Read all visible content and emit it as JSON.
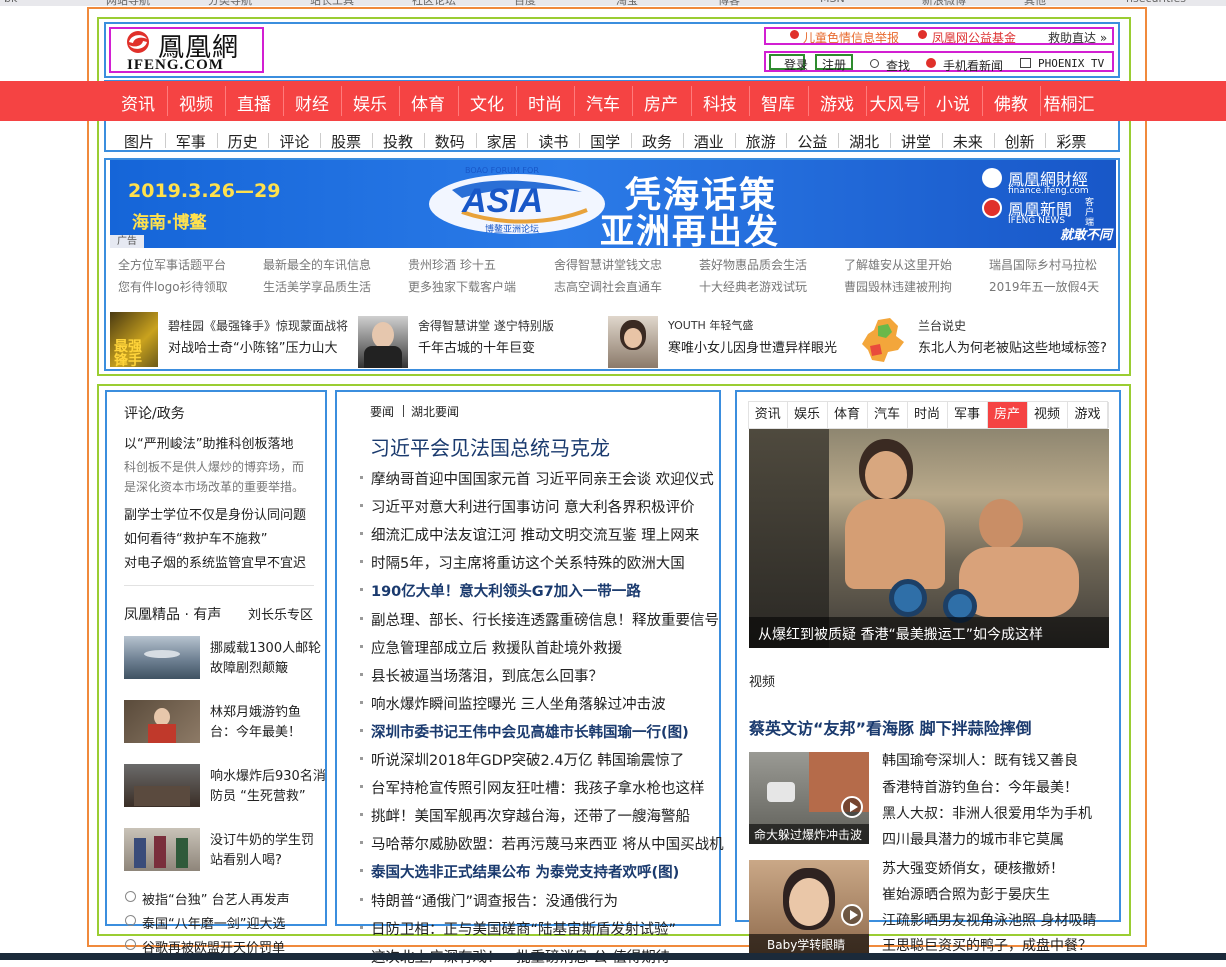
{
  "bookmarks": [
    "bk",
    "网站导航",
    "分类导航",
    "站长工具",
    "社区论坛",
    "百度",
    "淘宝",
    "博客",
    "MSN",
    "新浪微博",
    "其他",
    "nsecurities"
  ],
  "header": {
    "logo_cn": "鳳凰網",
    "logo_en": "IFENG.COM",
    "top_links": [
      "儿童色情信息举报",
      "凤凰网公益基金",
      "救助直达 »"
    ],
    "util": {
      "login": "登录",
      "register": "注册",
      "search": "查找",
      "mobile": "手机看新闻",
      "phoenix_tv": "PHOENIX TV"
    }
  },
  "nav_primary": [
    "资讯",
    "视频",
    "直播",
    "财经",
    "娱乐",
    "体育",
    "文化",
    "时尚",
    "汽车",
    "房产",
    "科技",
    "智库",
    "游戏",
    "大风号",
    "小说",
    "佛教",
    "梧桐汇"
  ],
  "nav_secondary": [
    "图片",
    "军事",
    "历史",
    "评论",
    "股票",
    "投教",
    "数码",
    "家居",
    "读书",
    "国学",
    "政务",
    "酒业",
    "旅游",
    "公益",
    "湖北",
    "讲堂",
    "未来",
    "创新",
    "彩票"
  ],
  "banner": {
    "date": "2019.3.26—29",
    "place": "海南·博鳌",
    "ad_tag": "广告",
    "forum_en": "ASIA",
    "forum_top": "BOAO FORUM FOR",
    "forum_cn": "博鳌亚洲论坛",
    "slogan1": "凭海话策",
    "slogan2": "亚洲再出发",
    "brand1": "鳳凰網財經",
    "brand1_url": "finance.ifeng.com",
    "brand2": "鳳凰新聞",
    "brand2_sub": "IFENG NEWS",
    "brand2_tag": "客户端",
    "brand2_slogan": "就敢不同"
  },
  "ad_links": [
    [
      "全方位军事话题平台",
      "最新最全的车讯信息",
      "贵州珍酒 珍十五",
      "舍得智慧讲堂钱文忠",
      "荟好物惠品质会生活",
      "了解雄安从这里开始",
      "瑞昌国际乡村马拉松"
    ],
    [
      "您有件logo衫待领取",
      "生活美学享品质生活",
      "更多独家下载客户端",
      "志高空调社会直通车",
      "十大经典老游戏试玩",
      "曹园毁林违建被刑拘",
      "2019年五一放假4天"
    ]
  ],
  "promos": [
    {
      "title": "碧桂园《最强锋手》惊现蒙面战将",
      "sub": "对战哈士奇“小陈铭”压力山大",
      "thumb": "最强锋手"
    },
    {
      "title": "舍得智慧讲堂 遂宁特别版",
      "sub": "千年古城的十年巨变"
    },
    {
      "title": "YOUTH 年轻气盛",
      "sub": "寒唯小女儿因身世遭异样眼光"
    },
    {
      "title": "兰台说史",
      "sub": "东北人为何老被贴这些地域标签?"
    }
  ],
  "left_col": {
    "title": "评论/政务",
    "lead": "以“严刑峻法”助推科创板落地",
    "desc": "科创板不是供人爆炒的博弈场，而是深化资本市场改革的重要举措。",
    "links": [
      "副学士学位不仅是身份认同问题",
      "如何看待“救护车不施救”",
      "对电子烟的系统监管宜早不宜迟"
    ],
    "jingpin_title": "凤凰精品 · 有声",
    "jingpin_link": "刘长乐专区",
    "items": [
      {
        "l1": "挪威载1300人邮轮",
        "l2": "故障剧烈颠簸"
      },
      {
        "l1": "林郑月娥游钓鱼",
        "l2": "台：今年最美！"
      },
      {
        "l1": "响水爆炸后930名消",
        "l2": "防员 “生死营救”"
      },
      {
        "l1": "没订牛奶的学生罚",
        "l2": "站看别人喝?"
      }
    ],
    "audio": [
      "被指“台独” 台艺人再发声",
      "泰国“八年磨一剑”迎大选",
      "谷歌再被欧盟开天价罚单"
    ]
  },
  "mid_col": {
    "tabs": [
      "要闻",
      "湖北要闻"
    ],
    "headline": "习近平会见法国总统马克龙",
    "news": [
      {
        "t": "摩纳哥首迎中国国家元首 习近平同亲王会谈 欢迎仪式",
        "b": false
      },
      {
        "t": "习近平对意大利进行国事访问 意大利各界积极评价",
        "b": false
      },
      {
        "t": "细流汇成中法友谊江河 推动文明交流互鉴 理上网来",
        "b": false
      },
      {
        "t": "时隔5年，习主席将重访这个关系特殊的欧洲大国",
        "b": false
      },
      {
        "t": "190亿大单！意大利领头G7加入一带一路",
        "b": true
      },
      {
        "t": "副总理、部长、行长接连透露重磅信息！释放重要信号",
        "b": false
      },
      {
        "t": "应急管理部成立后 救援队首赴境外救援",
        "b": false
      },
      {
        "t": "县长被逼当场落泪，到底怎么回事？",
        "b": false
      },
      {
        "t": "响水爆炸瞬间监控曝光 三人坐角落躲过冲击波",
        "b": false
      },
      {
        "t": "深圳市委书记王伟中会见高雄市长韩国瑜一行(图)",
        "b": true
      },
      {
        "t": "听说深圳2018年GDP突破2.4万亿 韩国瑜震惊了",
        "b": false
      },
      {
        "t": "台军持枪宣传照引网友狂吐槽：我孩子拿水枪也这样",
        "b": false
      },
      {
        "t": "挑衅！美国军舰再次穿越台海，还带了一艘海警船",
        "b": false
      },
      {
        "t": "马哈蒂尔威胁欧盟：若再污蔑马来西亚 将从中国买战机",
        "b": false
      },
      {
        "t": "泰国大选非正式结果公布 为泰党支持者欢呼(图)",
        "b": true
      },
      {
        "t": "特朗普“通俄门”调查报告：没通俄行为",
        "b": false
      },
      {
        "t": "日防卫相：正与美国磋商“陆基宙斯盾发射试验”",
        "b": false
      },
      {
        "t": "这次北上广深有戏！一批重磅消息 公 值得期待",
        "b": false
      }
    ]
  },
  "right_col": {
    "tabs": [
      "资讯",
      "娱乐",
      "体育",
      "汽车",
      "时尚",
      "军事",
      "房产",
      "视频",
      "游戏"
    ],
    "active_tab": "房产",
    "photo_caption": "从爆红到被质疑 香港“最美搬运工”如今成这样",
    "video_title": "视频",
    "video_headline": "蔡英文访“友邦”看海豚 脚下拌蒜险摔倒",
    "v1_caption": "命大躲过爆炸冲击波",
    "v1_links": [
      "韩国瑜夸深圳人：既有钱又善良",
      "香港特首游钓鱼台：今年最美！",
      "黑人大叔：非洲人很爱用华为手机",
      "四川最具潜力的城市非它莫属"
    ],
    "v2_caption": "Baby学转眼睛",
    "v2_links": [
      "苏大强变娇俏女，硬核撒娇！",
      "崔始源晒合照为彭于晏庆生",
      "江疏影晒男友视角泳池照 身材吸睛",
      "王思聪巨资买的鸭子，成盘中餐？"
    ]
  },
  "colors": {
    "nav_red": "#f54343",
    "active_tab": "#f54343",
    "annot_orange": "#f08a3c",
    "annot_green": "#9acd32",
    "annot_blue": "#3b8ede",
    "annot_magenta": "#d21fd2"
  }
}
